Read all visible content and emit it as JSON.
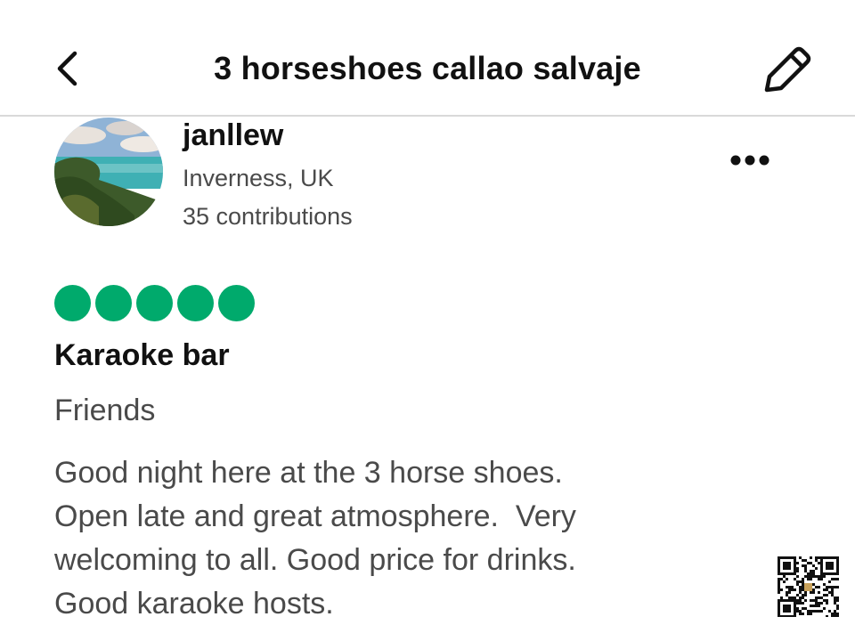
{
  "header": {
    "title": "3 horseshoes callao salvaje",
    "back_icon": "chevron-left-icon",
    "edit_icon": "pencil-icon"
  },
  "reviewer": {
    "username": "janllew",
    "location": "Inverness, UK",
    "contributions": "35 contributions",
    "more_icon": "more-horizontal-icon"
  },
  "review": {
    "rating": 5,
    "rating_max": 5,
    "rating_color": "#00aa6c",
    "title": "Karaoke bar",
    "trip_type": "Friends",
    "body_lines": [
      "Good night here at the 3 horse shoes.",
      "Open late and great atmosphere.  Very",
      "welcoming to all. Good price for drinks.",
      "Good karaoke hosts."
    ]
  }
}
